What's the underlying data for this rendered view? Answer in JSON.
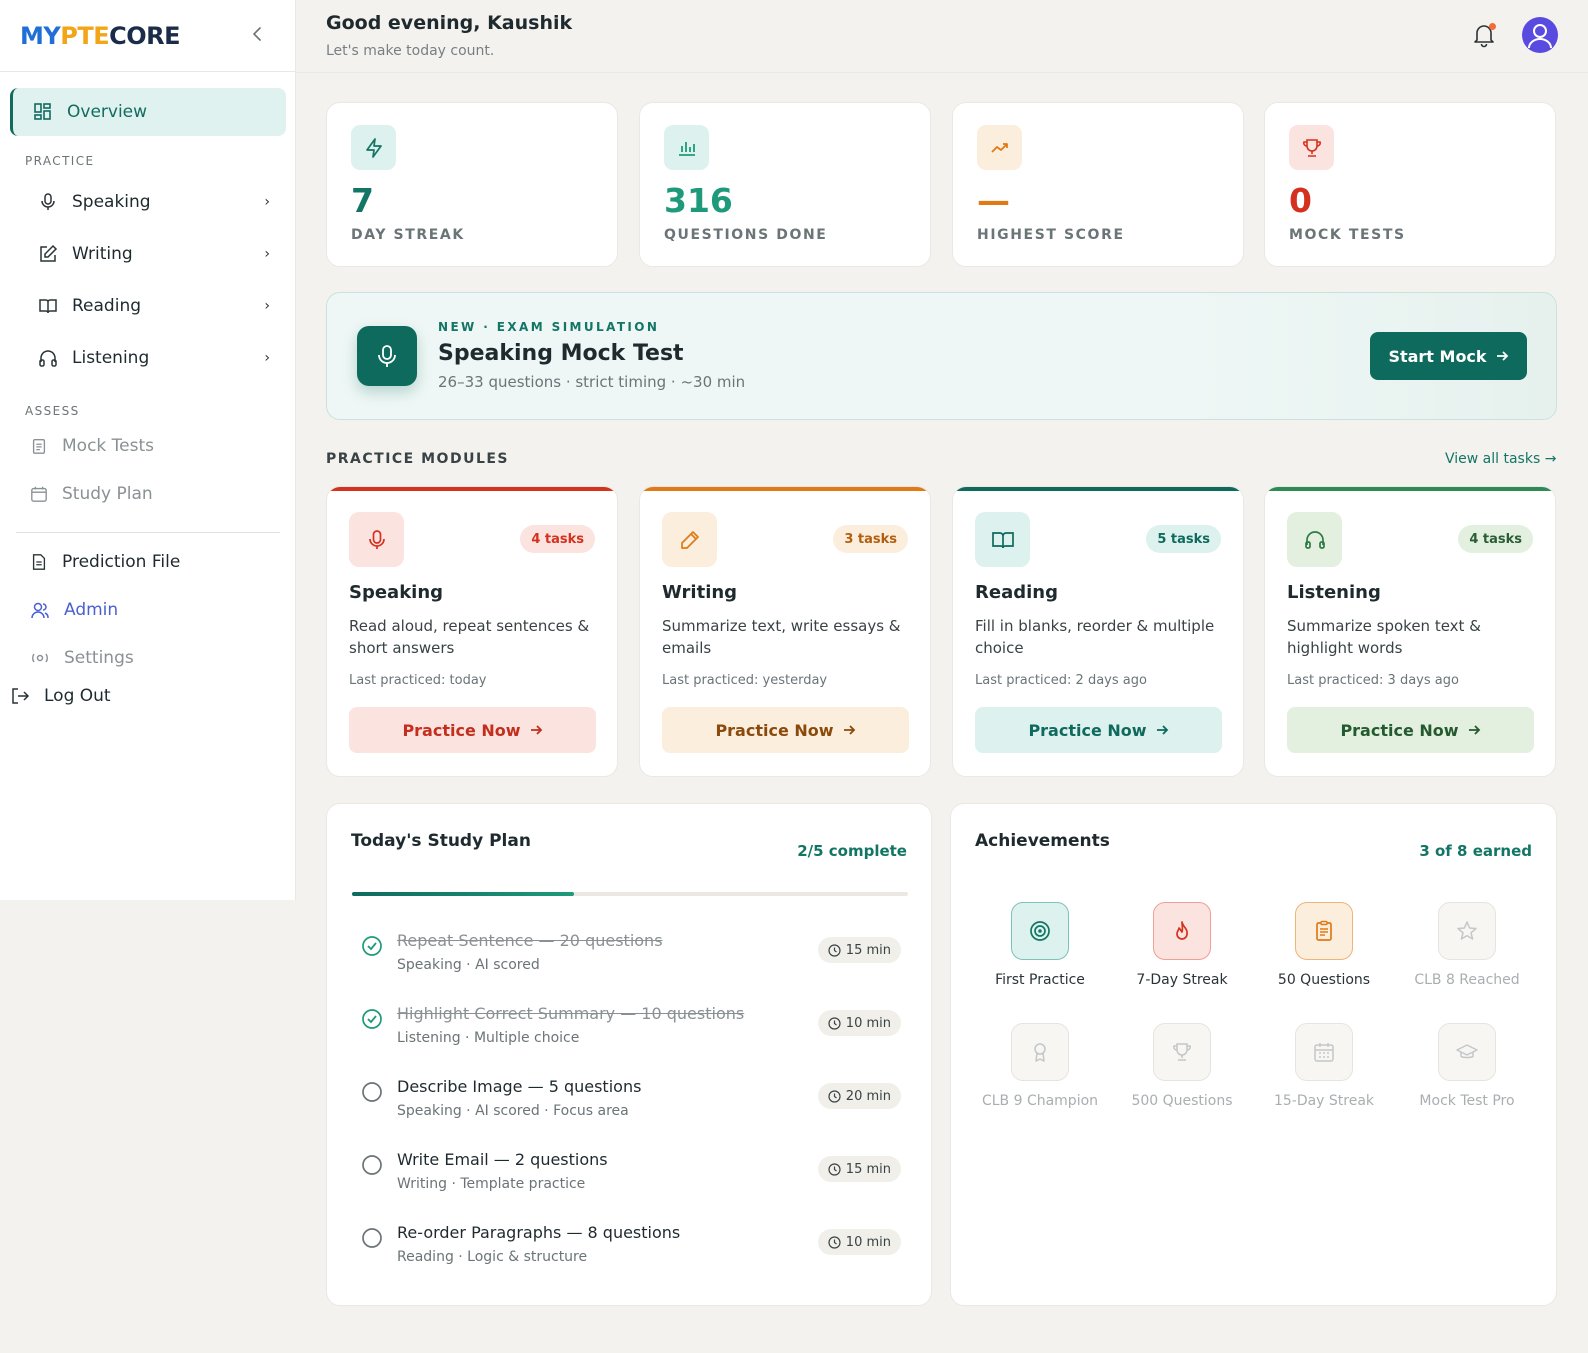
{
  "brand": {
    "part1": "MY",
    "part2": "PTE",
    "part3": "CORE"
  },
  "sidebar": {
    "overview": "Overview",
    "practice_label": "PRACTICE",
    "practice_items": [
      {
        "label": "Speaking"
      },
      {
        "label": "Writing"
      },
      {
        "label": "Reading"
      },
      {
        "label": "Listening"
      }
    ],
    "assess_label": "ASSESS",
    "mock_tests": "Mock Tests",
    "study_plan": "Study Plan",
    "prediction_file": "Prediction File",
    "admin": "Admin",
    "settings": "Settings",
    "logout": "Log Out"
  },
  "header": {
    "greeting": "Good evening, Kaushik",
    "subtitle": "Let's make today count."
  },
  "stats": [
    {
      "value": "7",
      "label": "DAY STREAK",
      "color": "#137565",
      "icon": "lightning-icon"
    },
    {
      "value": "316",
      "label": "QUESTIONS DONE",
      "color": "#1e9a7a",
      "icon": "bar-chart-icon"
    },
    {
      "value": "—",
      "label": "HIGHEST SCORE",
      "color": "#e07a16",
      "icon": "trending-up-icon"
    },
    {
      "value": "0",
      "label": "MOCK TESTS",
      "color": "#d4321e",
      "icon": "trophy-icon"
    }
  ],
  "banner": {
    "tag": "NEW · EXAM SIMULATION",
    "title": "Speaking Mock Test",
    "desc": "26–33 questions · strict timing · ~30 min",
    "cta": "Start Mock"
  },
  "modules_section": {
    "title": "PRACTICE MODULES",
    "view_all": "View all tasks →"
  },
  "modules": [
    {
      "name": "Speaking",
      "badge": "4 tasks",
      "desc": "Read aloud, repeat sentences & short answers",
      "last": "Last practiced: today",
      "btn": "Practice Now",
      "accent": "#d4321e"
    },
    {
      "name": "Writing",
      "badge": "3 tasks",
      "desc": "Summarize text, write essays & emails",
      "last": "Last practiced: yesterday",
      "btn": "Practice Now",
      "accent": "#e07a16"
    },
    {
      "name": "Reading",
      "badge": "5 tasks",
      "desc": "Fill in blanks, reorder & multiple choice",
      "last": "Last practiced: 2 days ago",
      "btn": "Practice Now",
      "accent": "#0f6a5e"
    },
    {
      "name": "Listening",
      "badge": "4 tasks",
      "desc": "Summarize spoken text & highlight words",
      "last": "Last practiced: 3 days ago",
      "btn": "Practice Now",
      "accent": "#2e8b57"
    }
  ],
  "study_plan": {
    "title": "Today's Study Plan",
    "complete": "2/5 complete",
    "progress_fraction": 0.4,
    "tasks": [
      {
        "title": "Repeat Sentence — 20 questions",
        "sub": "Speaking · AI scored",
        "dur": "15 min",
        "done": true
      },
      {
        "title": "Highlight Correct Summary — 10 questions",
        "sub": "Listening · Multiple choice",
        "dur": "10 min",
        "done": true
      },
      {
        "title": "Describe Image — 5 questions",
        "sub": "Speaking · AI scored · Focus area",
        "dur": "20 min",
        "done": false
      },
      {
        "title": "Write Email — 2 questions",
        "sub": "Writing · Template practice",
        "dur": "15 min",
        "done": false
      },
      {
        "title": "Re-order Paragraphs — 8 questions",
        "sub": "Reading · Logic & structure",
        "dur": "10 min",
        "done": false
      }
    ]
  },
  "achievements": {
    "title": "Achievements",
    "earned": "3 of 8 earned",
    "items": [
      {
        "label": "First Practice",
        "earned": true,
        "icon": "target-icon"
      },
      {
        "label": "7-Day Streak",
        "earned": true,
        "icon": "flame-icon"
      },
      {
        "label": "50 Questions",
        "earned": true,
        "icon": "clipboard-icon"
      },
      {
        "label": "CLB 8 Reached",
        "earned": false,
        "icon": "star-icon"
      },
      {
        "label": "CLB 9 Champion",
        "earned": false,
        "icon": "award-icon"
      },
      {
        "label": "500 Questions",
        "earned": false,
        "icon": "trophy-icon"
      },
      {
        "label": "15-Day Streak",
        "earned": false,
        "icon": "calendar-icon"
      },
      {
        "label": "Mock Test Pro",
        "earned": false,
        "icon": "graduation-cap-icon"
      }
    ]
  }
}
